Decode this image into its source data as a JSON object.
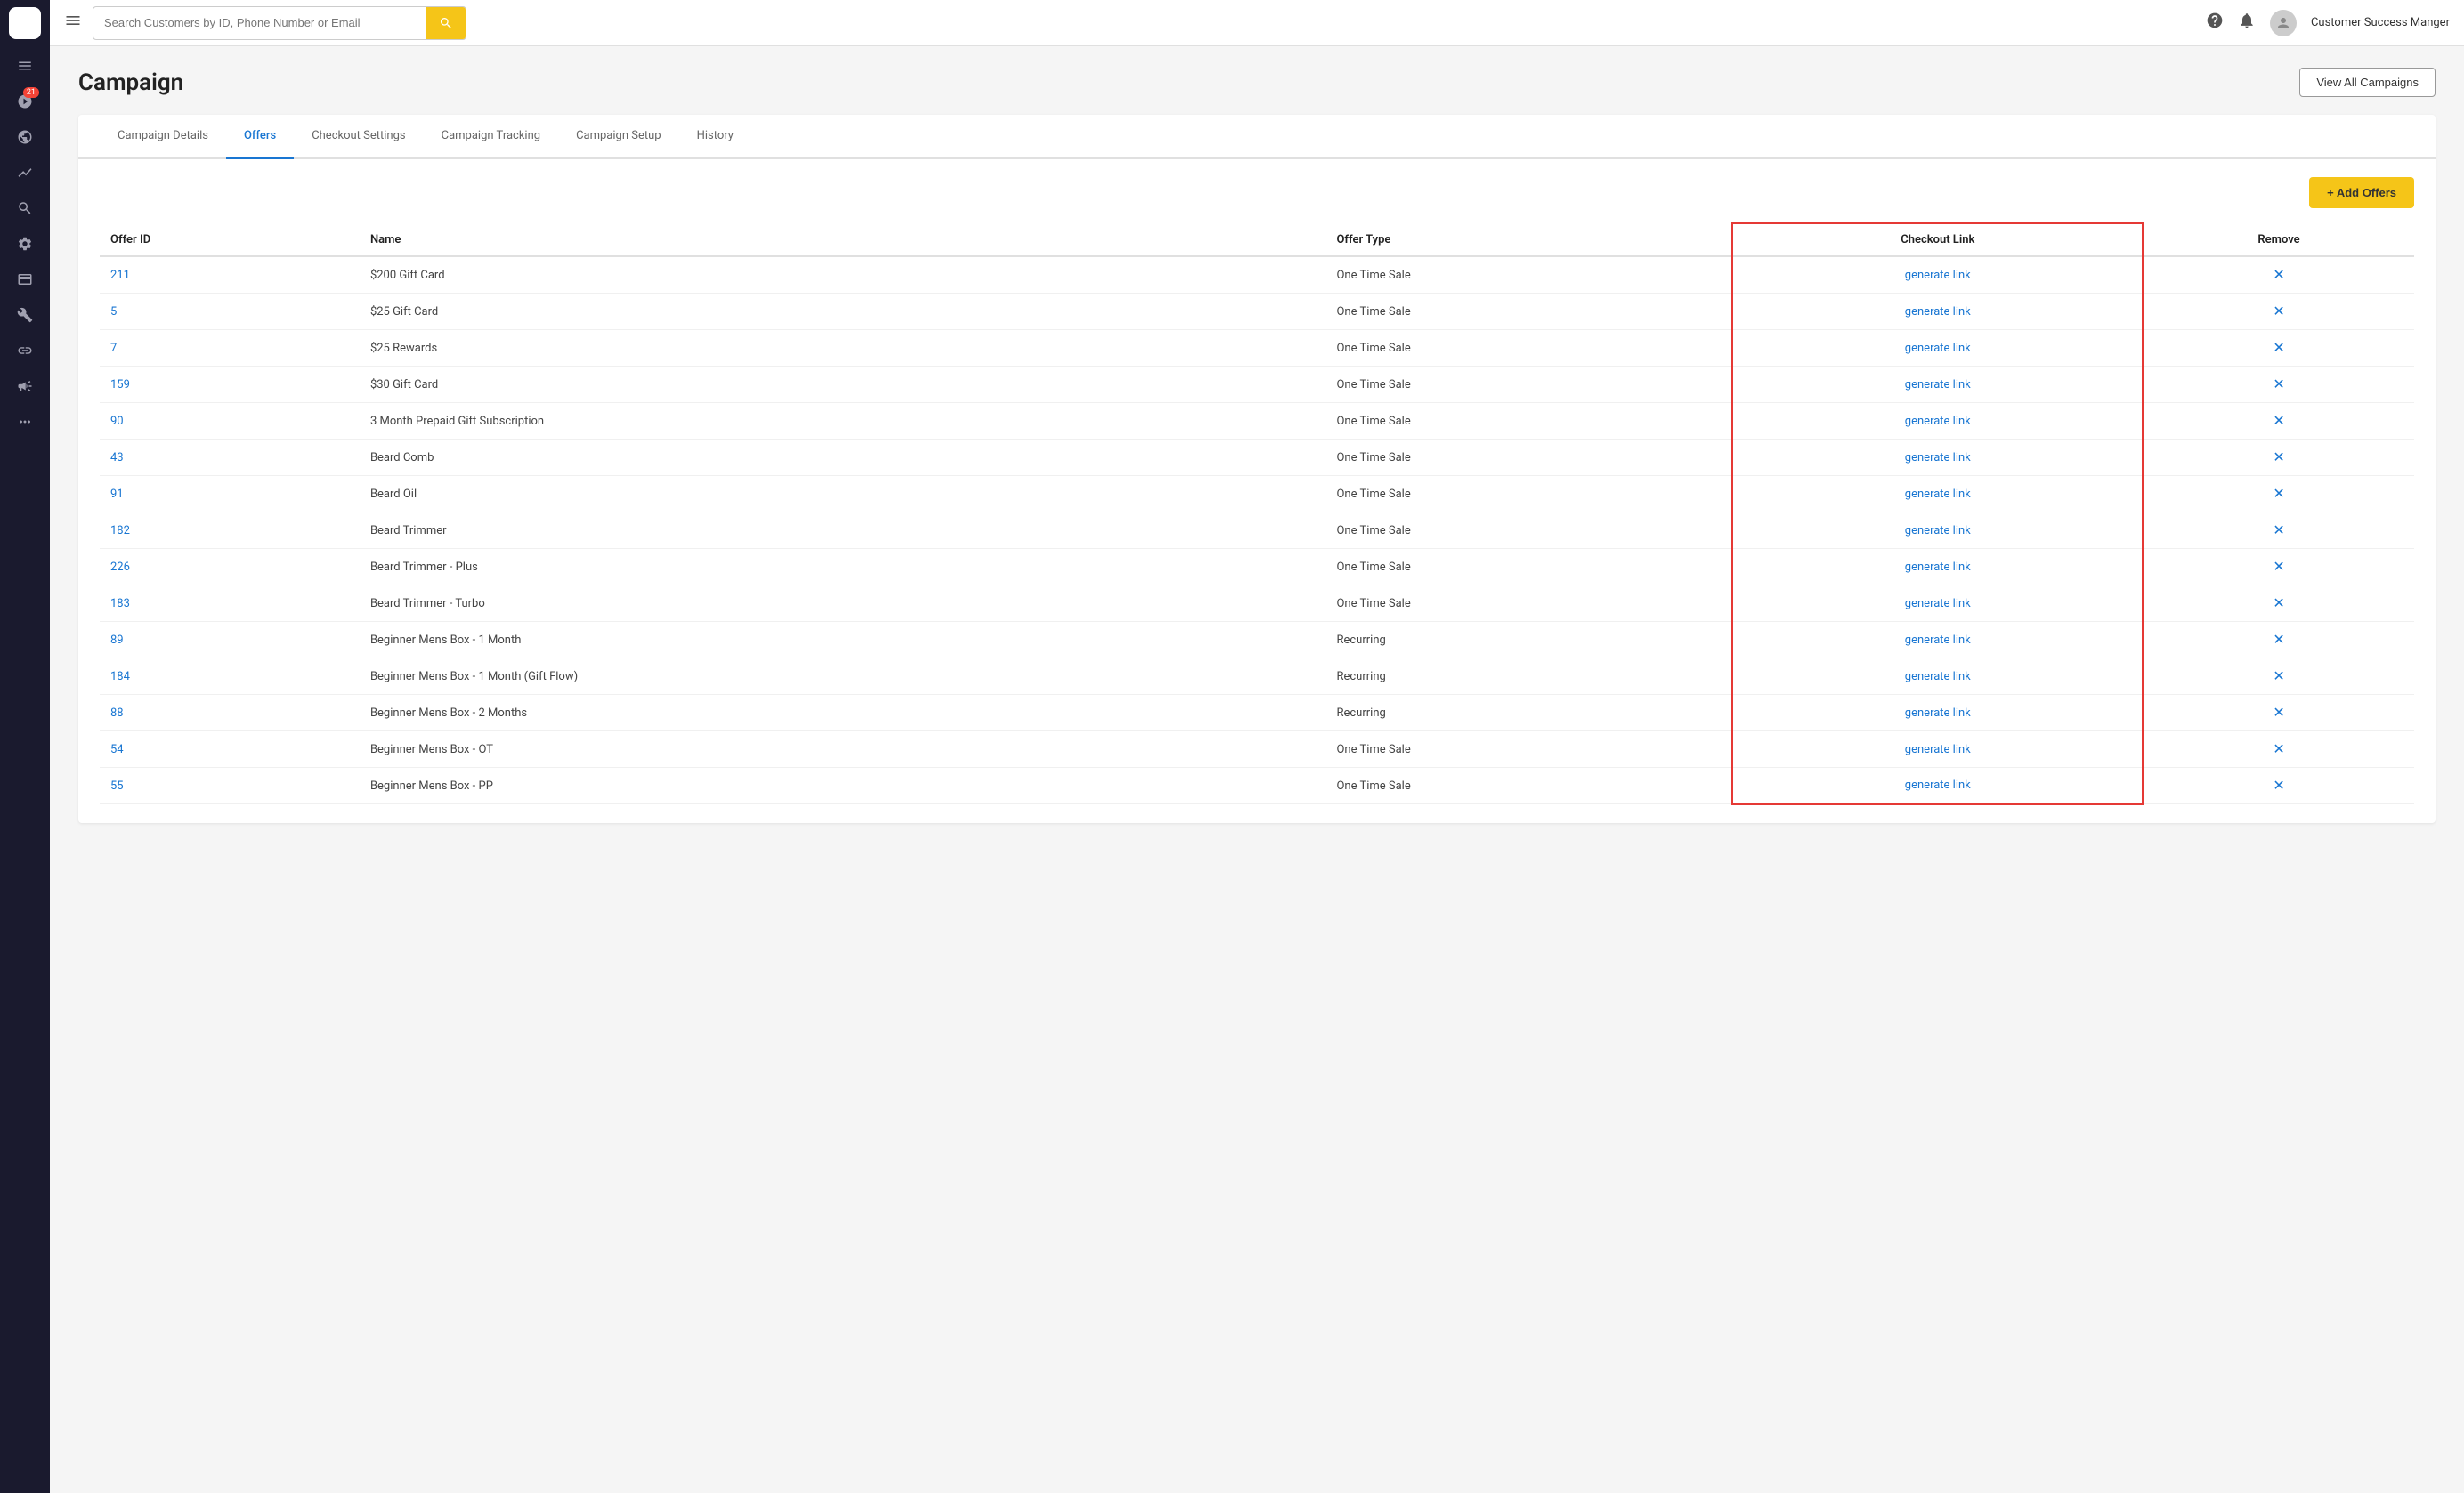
{
  "app": {
    "title": "Campaign"
  },
  "topnav": {
    "search_placeholder": "Search Customers by ID, Phone Number or Email",
    "user_name": "Customer Success Manger"
  },
  "header": {
    "title": "Campaign",
    "view_all_label": "View All Campaigns"
  },
  "tabs": [
    {
      "id": "campaign-details",
      "label": "Campaign Details",
      "active": false
    },
    {
      "id": "offers",
      "label": "Offers",
      "active": true
    },
    {
      "id": "checkout-settings",
      "label": "Checkout Settings",
      "active": false
    },
    {
      "id": "campaign-tracking",
      "label": "Campaign Tracking",
      "active": false
    },
    {
      "id": "campaign-setup",
      "label": "Campaign Setup",
      "active": false
    },
    {
      "id": "history",
      "label": "History",
      "active": false
    }
  ],
  "toolbar": {
    "add_offers_label": "+ Add Offers"
  },
  "table": {
    "columns": {
      "offer_id": "Offer ID",
      "name": "Name",
      "offer_type": "Offer Type",
      "checkout_link": "Checkout Link",
      "remove": "Remove"
    },
    "generate_link_label": "generate link",
    "rows": [
      {
        "id": "211",
        "name": "$200 Gift Card",
        "offer_type": "One Time Sale"
      },
      {
        "id": "5",
        "name": "$25 Gift Card",
        "offer_type": "One Time Sale"
      },
      {
        "id": "7",
        "name": "$25 Rewards",
        "offer_type": "One Time Sale"
      },
      {
        "id": "159",
        "name": "$30 Gift Card",
        "offer_type": "One Time Sale"
      },
      {
        "id": "90",
        "name": "3 Month Prepaid Gift Subscription",
        "offer_type": "One Time Sale"
      },
      {
        "id": "43",
        "name": "Beard Comb",
        "offer_type": "One Time Sale"
      },
      {
        "id": "91",
        "name": "Beard Oil",
        "offer_type": "One Time Sale"
      },
      {
        "id": "182",
        "name": "Beard Trimmer",
        "offer_type": "One Time Sale"
      },
      {
        "id": "226",
        "name": "Beard Trimmer - Plus",
        "offer_type": "One Time Sale"
      },
      {
        "id": "183",
        "name": "Beard Trimmer - Turbo",
        "offer_type": "One Time Sale"
      },
      {
        "id": "89",
        "name": "Beginner Mens Box - 1 Month",
        "offer_type": "Recurring"
      },
      {
        "id": "184",
        "name": "Beginner Mens Box - 1 Month (Gift Flow)",
        "offer_type": "Recurring"
      },
      {
        "id": "88",
        "name": "Beginner Mens Box - 2 Months",
        "offer_type": "Recurring"
      },
      {
        "id": "54",
        "name": "Beginner Mens Box - OT",
        "offer_type": "One Time Sale"
      },
      {
        "id": "55",
        "name": "Beginner Mens Box - PP",
        "offer_type": "One Time Sale"
      }
    ]
  },
  "sidebar": {
    "items": [
      {
        "id": "rocket",
        "icon": "🚀",
        "badge": "21"
      },
      {
        "id": "globe",
        "icon": "🌐"
      },
      {
        "id": "chart",
        "icon": "📈"
      },
      {
        "id": "search",
        "icon": "🔍"
      },
      {
        "id": "gear",
        "icon": "⚙️"
      },
      {
        "id": "card",
        "icon": "💳"
      },
      {
        "id": "wrench",
        "icon": "🔧"
      },
      {
        "id": "link",
        "icon": "🔗"
      },
      {
        "id": "megaphone",
        "icon": "📣"
      },
      {
        "id": "more",
        "icon": "···"
      }
    ]
  }
}
